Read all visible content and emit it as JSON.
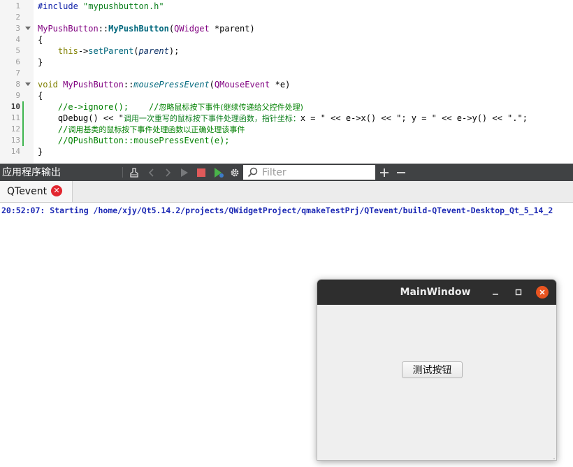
{
  "editor": {
    "lines": [
      {
        "n": "1"
      },
      {
        "n": "2"
      },
      {
        "n": "3"
      },
      {
        "n": "4"
      },
      {
        "n": "5"
      },
      {
        "n": "6"
      },
      {
        "n": "7"
      },
      {
        "n": "8"
      },
      {
        "n": "9"
      },
      {
        "n": "10"
      },
      {
        "n": "11"
      },
      {
        "n": "12"
      },
      {
        "n": "13"
      },
      {
        "n": "14"
      }
    ],
    "tokens": {
      "l1_include": "#include",
      "l1_file": " \"mypushbutton.h\"",
      "l3_class": "MyPushButton",
      "l3_sep": "::",
      "l3_ctor": "MyPushButton",
      "l3_open": "(",
      "l3_type": "QWidget",
      "l3_rest": " *parent)",
      "l4": "{",
      "l5_this": "this",
      "l5_arrow": "->",
      "l5_fn": "setParent",
      "l5_open": "(",
      "l5_arg": "parent",
      "l5_close": ");",
      "l6": "}",
      "l8_void": "void",
      "l8_sp": " ",
      "l8_class": "MyPushButton",
      "l8_sep": "::",
      "l8_fn": "mousePressEvent",
      "l8_open": "(",
      "l8_type": "QMouseEvent",
      "l8_rest": " *e)",
      "l9": "{",
      "l10_code": "    //e->ignore();    //",
      "l10_cn": "忽略鼠标按下事件(继续传递给父控件处理)",
      "l11_a": "    qDebug() << \"",
      "l11_cn1": "调用一次重写的鼠标按下事件处理函数，指针坐标：",
      "l11_b": "x = \" << e->x() << \"; y = \" << e->y() << \".\";",
      "l12_pre": "    //",
      "l12_cn": "调用基类的鼠标按下事件处理函数以正确处理该事件",
      "l13": "    //QPushButton::mousePressEvent(e);",
      "l14": "}"
    }
  },
  "output_pane": {
    "title": "应用程序输出",
    "filter_placeholder": "Filter",
    "icons": [
      "clear-icon",
      "prev-icon",
      "next-icon",
      "run-icon",
      "stop-icon",
      "debug-run-icon",
      "settings-icon",
      "zoom-in-icon",
      "zoom-out-icon"
    ],
    "tab_label": "QTevent",
    "output_line": "20:52:07: Starting /home/xjy/Qt5.14.2/projects/QWidgetProject/qmakeTestPrj/QTevent/build-QTevent-Desktop_Qt_5_14_2"
  },
  "window": {
    "title": "MainWindow",
    "button_label": "测试按钮",
    "accent_close": "#e95420"
  },
  "colors": {
    "toolbar_bg": "#404244",
    "output_text": "#1c29b4",
    "change_marker": "#3fb54f"
  }
}
